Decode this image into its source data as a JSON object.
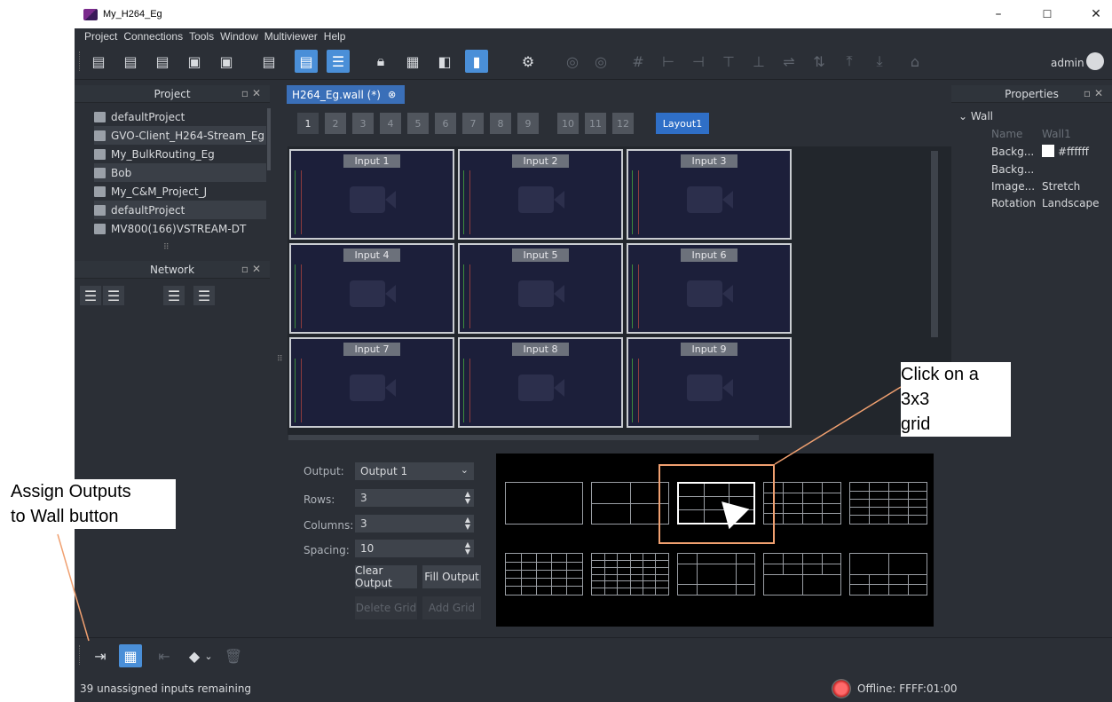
{
  "window": {
    "title": "My_H264_Eg",
    "minimize": "–",
    "maximize": "☐",
    "close": "✕"
  },
  "menu": [
    "Project",
    "Connections",
    "Tools",
    "Window",
    "Multiviewer",
    "Help"
  ],
  "toolbar": {
    "user": "admin"
  },
  "project_panel": {
    "title": "Project",
    "items": [
      "defaultProject",
      "GVO-Client_H264-Stream_Eg",
      "My_BulkRouting_Eg",
      "Bob",
      "My_C&M_Project_J",
      "defaultProject",
      "MV800(166)VSTREAM-DT"
    ]
  },
  "network_panel": {
    "title": "Network"
  },
  "editor": {
    "tab_label": "H264_Eg.wall (*)",
    "pages": [
      "1",
      "2",
      "3",
      "4",
      "5",
      "6",
      "7",
      "8",
      "9",
      "10",
      "11",
      "12"
    ],
    "layout_button": "Layout1",
    "inputs": [
      "Input 1",
      "Input 2",
      "Input 3",
      "Input 4",
      "Input 5",
      "Input 6",
      "Input 7",
      "Input 8",
      "Input 9"
    ]
  },
  "layout_controls": {
    "output_label": "Output:",
    "output_value": "Output 1",
    "rows_label": "Rows:",
    "rows_value": "3",
    "columns_label": "Columns:",
    "columns_value": "3",
    "spacing_label": "Spacing:",
    "spacing_value": "10",
    "clear_output": "Clear Output",
    "fill_output": "Fill Output",
    "delete_grid": "Delete Grid",
    "add_grid": "Add Grid"
  },
  "properties": {
    "title": "Properties",
    "section": "Wall",
    "rows": [
      {
        "key": "Name",
        "value": "Wall1"
      },
      {
        "key": "Backg...",
        "value": "#ffffff"
      },
      {
        "key": "Backg...",
        "value": ""
      },
      {
        "key": "Image...",
        "value": "Stretch"
      },
      {
        "key": "Rotation",
        "value": "Landscape"
      }
    ]
  },
  "status": {
    "message": "39 unassigned inputs remaining",
    "connection": "Offline: FFFF:01:00"
  },
  "callouts": {
    "grid": [
      "Click on a 3x3",
      "grid"
    ],
    "assign": [
      "Assign Outputs",
      "to Wall button"
    ]
  },
  "colors": {
    "accent": "#4a8fd8",
    "callout_line": "#f0a070",
    "tab": "#3a6fb8"
  }
}
